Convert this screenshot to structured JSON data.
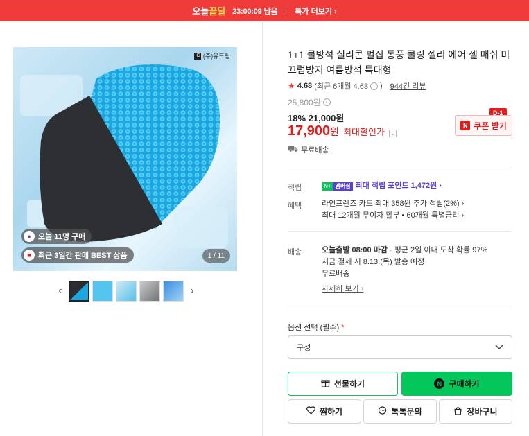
{
  "topbar": {
    "brand_a": "오늘",
    "brand_b": "끝딜",
    "timer": "23:00:09 남음",
    "more": "특가 더보기 ›"
  },
  "hero": {
    "logo_text": "(주)유드림",
    "today_buy": "오늘 11명 구매",
    "best": "최근 3일간 판매 BEST 상품",
    "counter": "1 / 11"
  },
  "product": {
    "title": "1+1 쿨방석 실리콘 벌집 통풍 쿨링 젤리 에어 젤 매쉬 미끄럼방지 여름방석 특대형",
    "rating": "4.68",
    "rating_recent": "(최근 6개월 4.63",
    "rating_recent_close": ")",
    "reviews": "944건 리뷰",
    "orig_price": "25,800원",
    "discount_line": "18% 21,000원",
    "final_price": "17,900",
    "final_unit": "원",
    "max_discount": "최대할인가",
    "coupon_label": "쿠폰 받기",
    "dday": "D-1",
    "free_ship": "무료배송"
  },
  "benefits": {
    "points_label": "적립",
    "points_n": "N+",
    "points_m": "멤버십",
    "points_text": "최대 적립 포인트 1,472원 ›",
    "benefit_label": "혜택",
    "benefit_line1": "라인프렌즈 카드 최대 358원 추가 적립(2%) ›",
    "benefit_line2": "최대 12개월 무이자 할부 • 60개월 특별금리 ›"
  },
  "shipping": {
    "label": "배송",
    "line1_bold": "오늘출발 08:00 마감",
    "line1_rest": " · 평균 2일 이내 도착 확률 97%",
    "line2": "지금 결제 시 8.13.(목) 발송 예정",
    "line3": "무료배송",
    "detail_link": "자세히 보기 ›"
  },
  "options": {
    "label": "옵션 선택 (필수)",
    "required_mark": "*",
    "select_value": "구성"
  },
  "buttons": {
    "gift": "선물하기",
    "buy": "구매하기",
    "wish": "찜하기",
    "talk": "톡톡문의",
    "cart": "장바구니"
  },
  "colors": {
    "topbar": "#f03b3b",
    "price_red": "#e21b1b",
    "naver_green": "#03c75a",
    "membership_purple": "#5a3fd6"
  }
}
